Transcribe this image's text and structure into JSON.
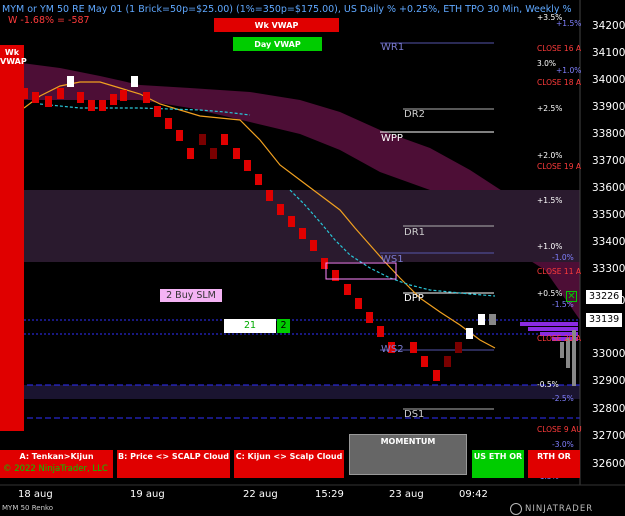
{
  "header": {
    "title": "MYM or YM 50 RE May 01 (1 Brick=50p=$25.00) (1%=350p=$175.00), US Daily % +0.25%, ETH TPO 30 Min, Weekly %",
    "subline": "W -1.68% = -587"
  },
  "vwap_buttons": {
    "weekly": "Wk VWAP",
    "daily": "Day VWAP"
  },
  "wk_vwap_tab": {
    "line1": "Wk",
    "line2": "VWAP"
  },
  "pivot_levels": [
    "WR1",
    "DR2",
    "WPP",
    "DR1",
    "WS1",
    "DPP",
    "WS2",
    "DS1"
  ],
  "close_labels": [
    "CLOSE 16 A",
    "CLOSE 18 A",
    "CLOSE 19 A",
    "CLOSE 11 A",
    "CLOSE 20 A",
    "CLOSE 9 AU"
  ],
  "percent_labels": [
    "+3.5%",
    "+1.5%",
    "3.0%",
    "+1.0%",
    "+2.5%",
    "+2.0%",
    "+1.5%",
    "+1.0%",
    "-1.0%",
    "+0.5%",
    "-1.5%",
    "-0.5%",
    "-2.5%",
    "-3.0%",
    "-1.5%"
  ],
  "price_axis": {
    "ticks": [
      "34200",
      "34100",
      "34000",
      "33900",
      "33800",
      "33700",
      "33600",
      "33500",
      "33400",
      "33300",
      "33200",
      "33000",
      "32900",
      "32800",
      "32700",
      "32600"
    ],
    "last_price": "33139",
    "order_price": "33226",
    "colors": {
      "last_price_box": "#ffffff",
      "order_price_box": "#ffffff",
      "order_mark": "#00cc00"
    }
  },
  "order": {
    "label": "2 Buy SLM",
    "quantity_value": "21",
    "quantity_badge": "2"
  },
  "time_axis": [
    "18 aug",
    "19 aug",
    "22 aug",
    "15:29",
    "23 aug",
    "09:42"
  ],
  "bottom_buttons": {
    "tenkan_kijun": "A: Tenkan>Kijun",
    "price_scalp": "B: Price <> SCALP Cloud",
    "kijun_scalp": "C: Kijun <> Scalp Cloud",
    "momentum": "MOMENTUM",
    "us_eth": "US ETH OR",
    "rth": "RTH OR"
  },
  "copyright": "© 2022 NinjaTrader, LLC",
  "brand": "NINJATRADER",
  "instrument": "MYM 50 Renko",
  "colors": {
    "up_brick": "#ffffff",
    "down_brick": "#e00000",
    "cloud": "#7a1a5a",
    "vwap_line": "#f0a020",
    "scalp_line": "#29c6d8",
    "accent_red": "#e00000",
    "accent_green": "#00cc00"
  }
}
